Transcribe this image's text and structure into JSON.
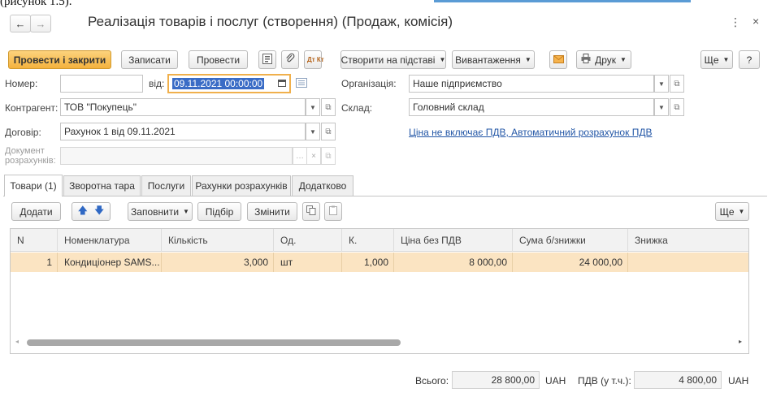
{
  "fragment_text": "(рисунок 1.5).",
  "window": {
    "title": "Реалізація товарів і послуг (створення) (Продаж, комісія)",
    "back_glyph": "←",
    "forward_glyph": "→",
    "menu_glyph": "⋮",
    "close_glyph": "×"
  },
  "toolbar": {
    "post_close": "Провести і закрити",
    "save": "Записати",
    "post": "Провести",
    "create_basis": "Створити на підставі",
    "upload": "Вивантаження",
    "print": "Друк",
    "more": "Ще",
    "help": "?",
    "dt_kt": "Дт Кт",
    "icons": [
      "document-structure-icon",
      "attach-icon",
      "dt-kt-icon",
      "email-icon",
      "printer-icon"
    ]
  },
  "form": {
    "number_label": "Номер:",
    "number_value": "",
    "date_label": "від:",
    "date_value": "09.11.2021 00:00:00",
    "org_label": "Організація:",
    "org_value": "Наше підприємство",
    "counterparty_label": "Контрагент:",
    "counterparty_value": "ТОВ \"Покупець\"",
    "warehouse_label": "Склад:",
    "warehouse_value": "Головний склад",
    "contract_label": "Договір:",
    "contract_value": "Рахунок 1 від 09.11.2021",
    "vat_link": "Ціна не включає ПДВ, Автоматичний розрахунок ПДВ",
    "settlement_label_1": "Документ",
    "settlement_label_2": "розрахунків:",
    "settlement_value": ""
  },
  "tabs": [
    {
      "label": "Товари (1)",
      "active": true
    },
    {
      "label": "Зворотна тара",
      "active": false
    },
    {
      "label": "Послуги",
      "active": false
    },
    {
      "label": "Рахунки розрахунків",
      "active": false
    },
    {
      "label": "Додатково",
      "active": false
    }
  ],
  "grid_toolbar": {
    "add": "Додати",
    "fill": "Заповнити",
    "select": "Підбір",
    "change": "Змінити",
    "more": "Ще"
  },
  "table": {
    "columns": [
      "N",
      "Номенклатура",
      "Кількість",
      "Од.",
      "К.",
      "Ціна без ПДВ",
      "Сума б/знижки",
      "Знижка"
    ],
    "rows": [
      [
        "1",
        "Кондиціонер SAMS...",
        "3,000",
        "шт",
        "1,000",
        "8 000,00",
        "24 000,00",
        ""
      ]
    ]
  },
  "totals": {
    "total_label": "Всього:",
    "total_value": "28 800,00",
    "currency": "UAH",
    "vat_label": "ПДВ (у т.ч.):",
    "vat_value": "4 800,00",
    "vat_currency": "UAH"
  },
  "colors": {
    "primary_button": "#f4b23d",
    "selected_row": "#fbe4c2",
    "link": "#2256a6",
    "focus_border": "#f0b04c",
    "selection": "#3a6cc6"
  }
}
